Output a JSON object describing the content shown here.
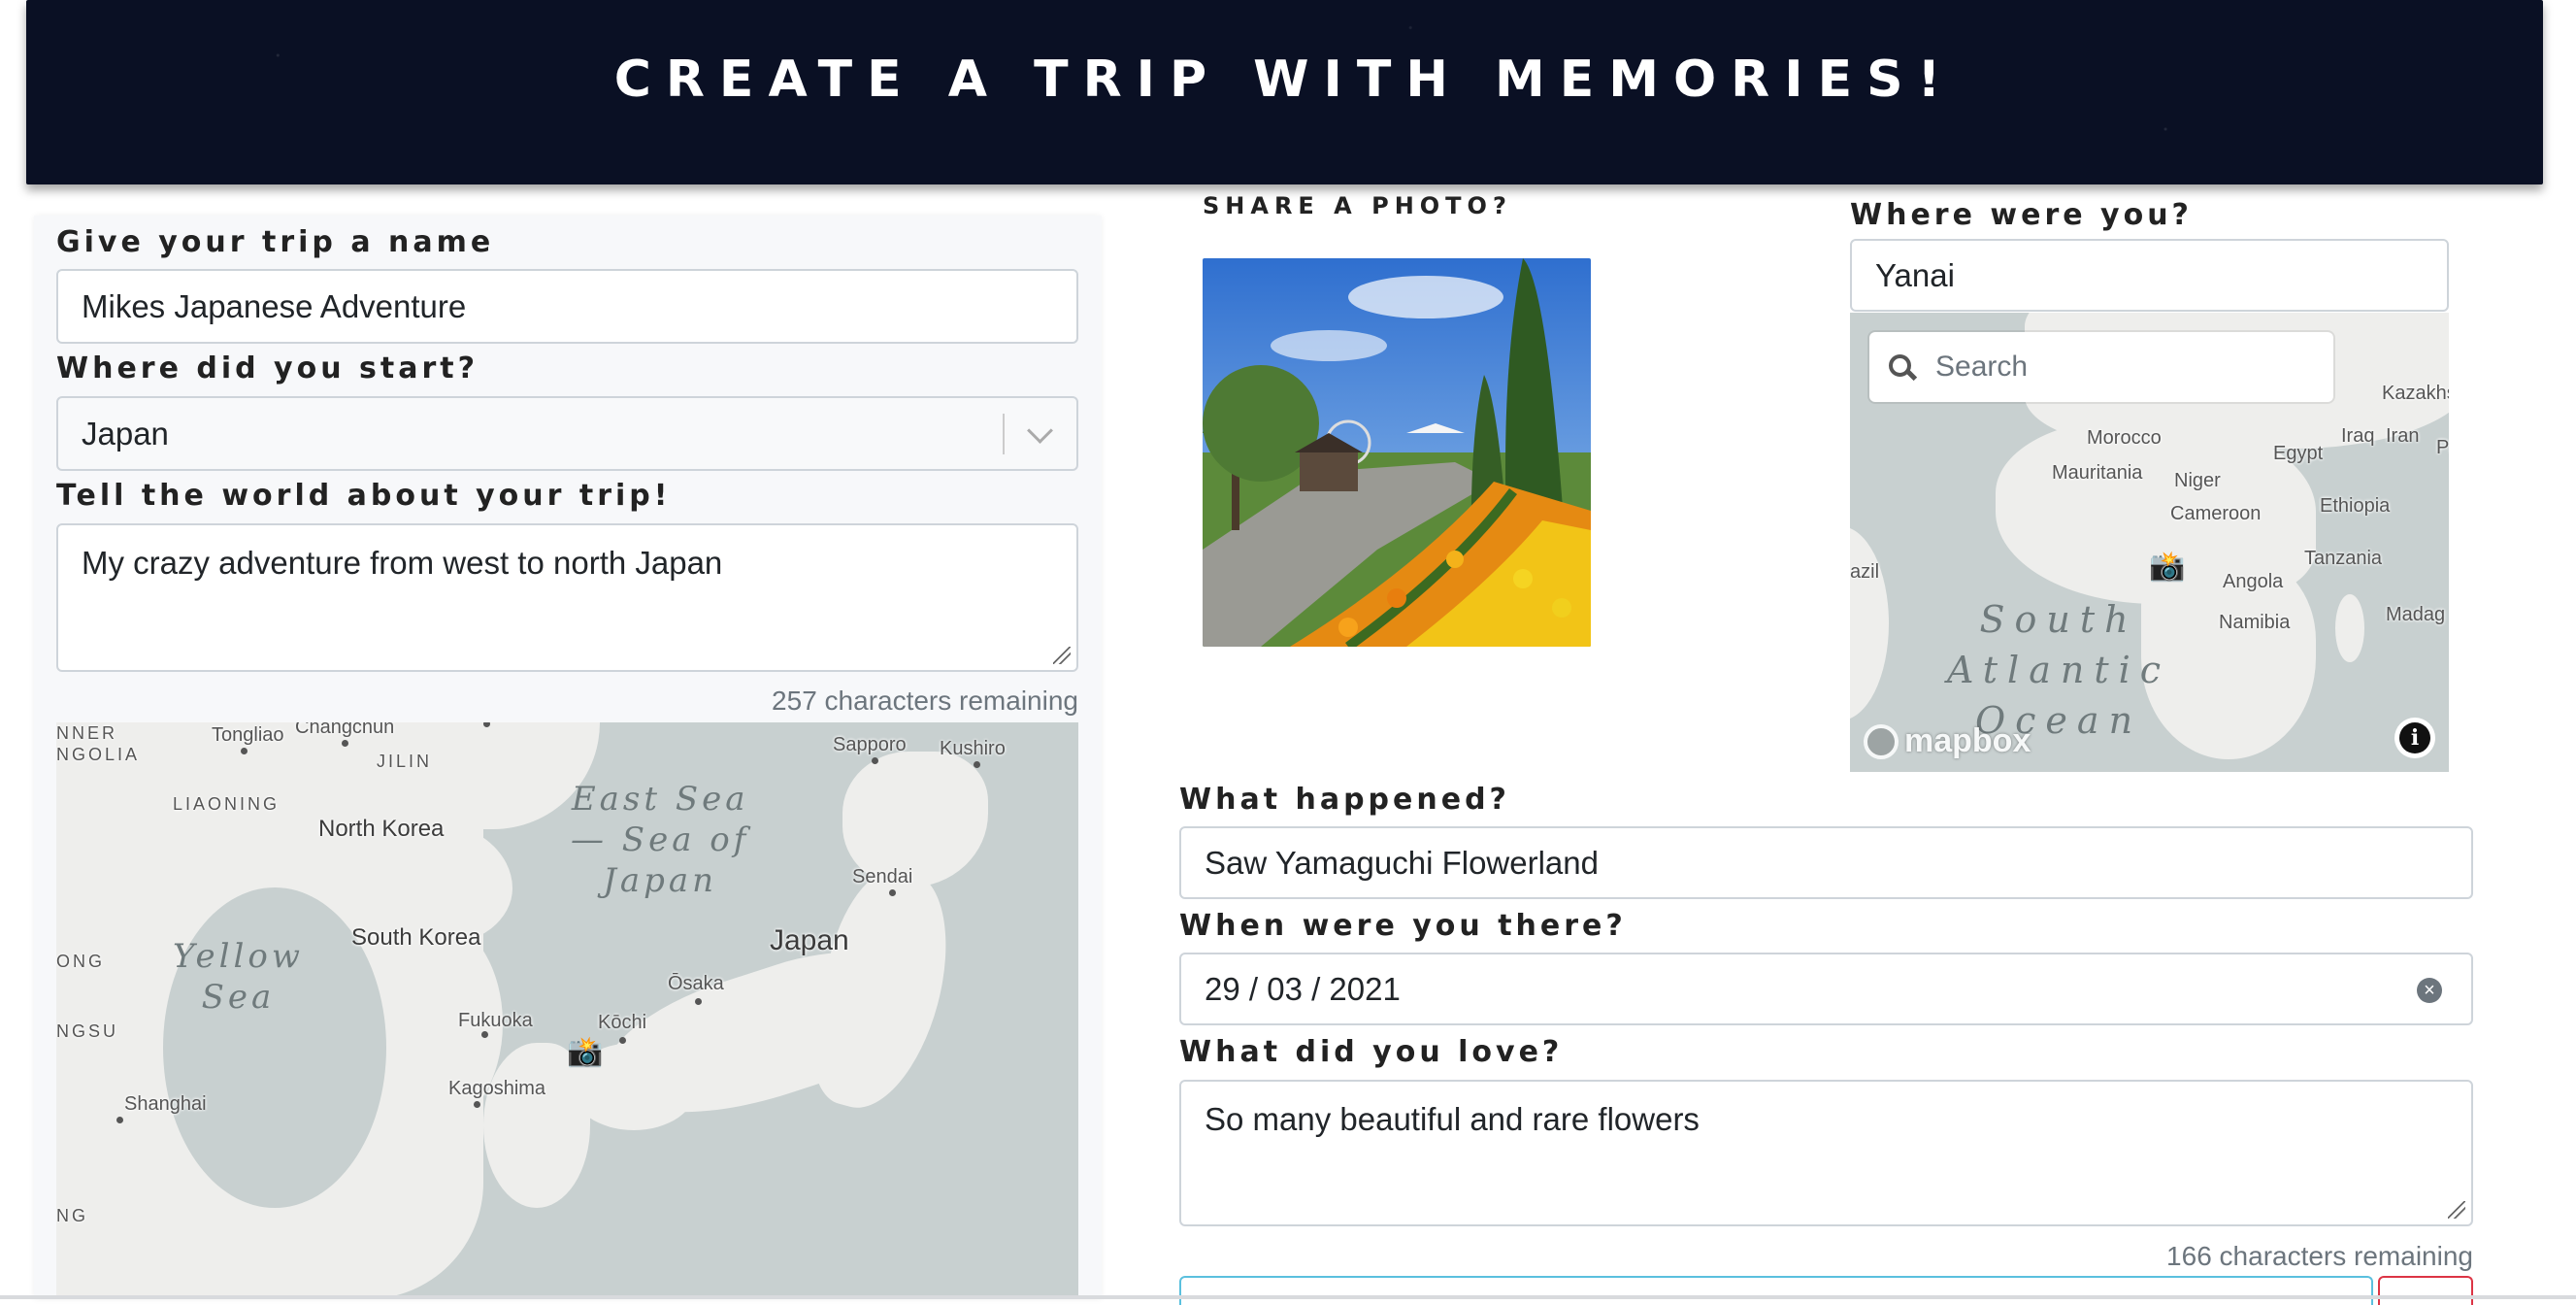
{
  "header": {
    "title": "Create a trip with memories!"
  },
  "trip_form": {
    "name_label": "Give your trip a name",
    "name_value": "Mikes Japanese Adventure",
    "start_label": "Where did you start?",
    "start_value": "Japan",
    "description_label": "Tell the world about your trip!",
    "description_value": "My crazy adventure from west to north Japan",
    "chars_remaining": "257 characters remaining",
    "map": {
      "labels": {
        "inner_mongolia": "NNER\nNGOLIA",
        "tongliao": "Tongliao",
        "changchun": "Changchun",
        "jilin": "JILIN",
        "liaoning": "LIAONING",
        "north_korea": "North Korea",
        "south_korea": "South Korea",
        "yellow_sea": "Yellow\nSea",
        "east_sea": "East Sea\n— Sea of\nJapan",
        "japan": "Japan",
        "sapporo": "Sapporo",
        "kushiro": "Kushiro",
        "sendai": "Sendai",
        "osaka": "Ōsaka",
        "kochi": "Kōchi",
        "fukuoka": "Fukuoka",
        "kagoshima": "Kagoshima",
        "shanghai": "Shanghai",
        "jiangsu": "NGSU",
        "dong": "ONG",
        "ng": "NG"
      },
      "marker_icon": "camera-icon"
    }
  },
  "memory_form": {
    "photo_label": "Share a photo?",
    "location_label": "Where were you?",
    "location_value": "Yanai",
    "map_search_placeholder": "Search",
    "map": {
      "labels": {
        "kazakhstan": "Kazakhs",
        "morocco": "Morocco",
        "iraq": "Iraq",
        "iran": "Iran",
        "pakistan": "Pa",
        "egypt": "Egypt",
        "mauritania": "Mauritania",
        "niger": "Niger",
        "ethiopia": "Ethiopia",
        "cameroon": "Cameroon",
        "brazil": "azil",
        "tanzania": "Tanzania",
        "angola": "Angola",
        "namibia": "Namibia",
        "madagascar": "Madag",
        "ocean": "South\nAtlantic\nOcean"
      },
      "logo": "mapbox",
      "info_icon": "i",
      "marker_icon": "camera-icon"
    },
    "happened_label": "What happened?",
    "happened_value": "Saw Yamaguchi Flowerland",
    "when_label": "When were you there?",
    "when_value": "29 / 03 / 2021",
    "clear_icon": "×",
    "loved_label": "What did you love?",
    "loved_value": "So many beautiful and rare flowers",
    "chars_remaining": "166 characters remaining"
  },
  "colors": {
    "header_bg": "#0a1024",
    "map_water": "#c8d0d0",
    "map_land": "#eeeeec",
    "focus_border": "#5bc0de",
    "danger": "#dc3545"
  }
}
